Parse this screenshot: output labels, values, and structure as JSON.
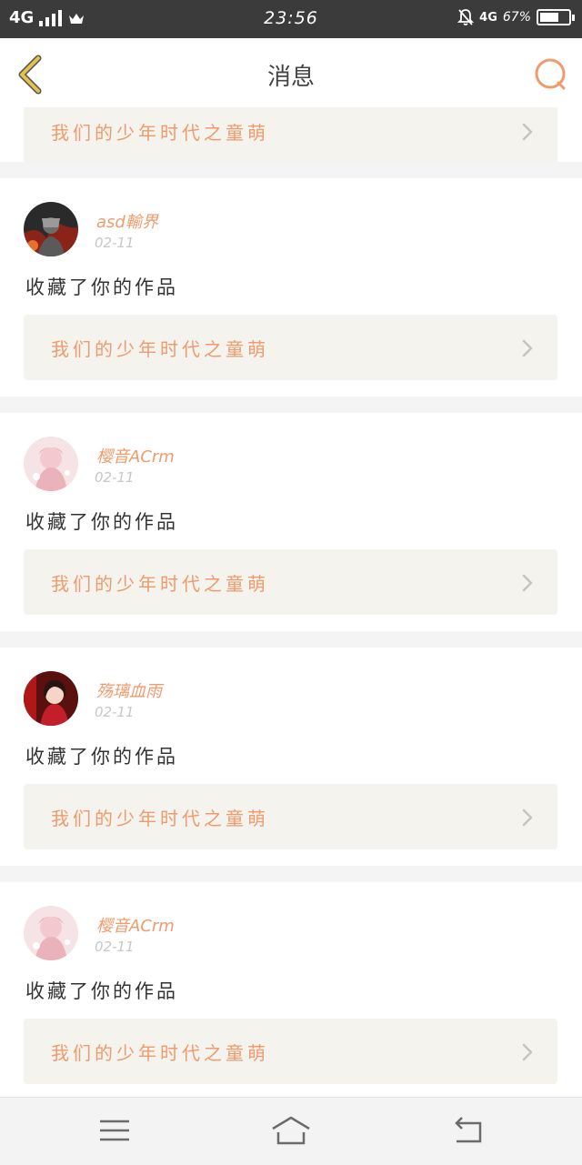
{
  "status": {
    "network": "4G",
    "time": "23:56",
    "network_right": "4G",
    "battery": "67%",
    "battery_level": 0.67
  },
  "header": {
    "title": "消息",
    "back_icon": "chevron-left-icon",
    "search_icon": "search-icon"
  },
  "partial_card": {
    "work_title": "我们的少年时代之童萌"
  },
  "messages": [
    {
      "user": "asd輸界",
      "date": "02-11",
      "action": "收藏了你的作品",
      "work_title": "我们的少年时代之童萌"
    },
    {
      "user": "樱音ACrm",
      "date": "02-11",
      "action": "收藏了你的作品",
      "work_title": "我们的少年时代之童萌"
    },
    {
      "user": "殇璃血雨",
      "date": "02-11",
      "action": "收藏了你的作品",
      "work_title": "我们的少年时代之童萌"
    },
    {
      "user": "樱音ACrm",
      "date": "02-11",
      "action": "收藏了你的作品",
      "work_title": "我们的少年时代之童萌"
    }
  ],
  "nav": {
    "menu_icon": "menu-icon",
    "home_icon": "home-icon",
    "back_icon": "return-icon"
  },
  "colors": {
    "accent": "#ef9b6d",
    "card_link_bg": "#f4f3ee",
    "statusbar_bg": "#3b3b3b",
    "back_chevron": "#e7c04a"
  }
}
